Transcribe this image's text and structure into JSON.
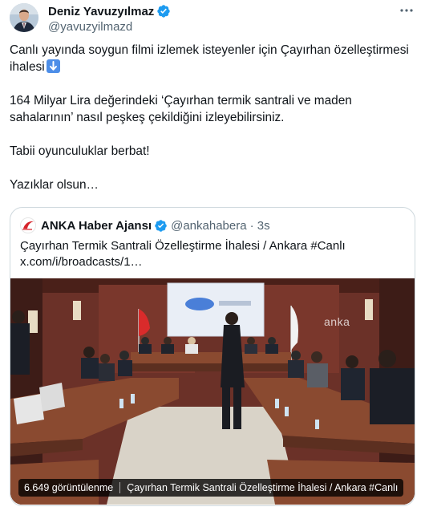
{
  "author": {
    "name": "Deniz Yavuzyılmaz",
    "handle": "@yavuzyilmazd"
  },
  "icons": {
    "avatar": "avatar-photo",
    "verified": "verified-badge-icon",
    "more": "more-options-icon",
    "emoji": "down-arrow-emoji-icon",
    "quote_avatar": "anka-logo"
  },
  "colors": {
    "verified": "#1d9bf0",
    "handle_gray": "#536471",
    "border": "#cfd9de",
    "emoji_blue": "#4d8ee8"
  },
  "tweet": {
    "line1": "Canlı yayında soygun filmi izlemek isteyenler için Çayırhan özelleştirmesi",
    "line2": "ihalesi",
    "line3": "164 Milyar Lira değerindeki ‘Çayırhan termik santrali ve maden",
    "line4": "sahalarının’ nasıl peşkeş çekildiğini izleyebilirsiniz.",
    "line5": "Tabii oyunculuklar berbat!",
    "line6": "Yazıklar olsun…"
  },
  "quote": {
    "name": "ANKA Haber Ajansı",
    "handle": "@ankahabera",
    "time": "· 3s",
    "text_line1": "Çayırhan Termik Santrali Özelleştirme İhalesi / Ankara #Canlı",
    "text_line2": "x.com/i/broadcasts/1…",
    "media": {
      "watermark": "anka",
      "views": "6.649 görüntülenme",
      "broadcast_title": "Çayırhan Termik Santrali Özelleştirme İhalesi / Ankara #Canlı"
    }
  }
}
